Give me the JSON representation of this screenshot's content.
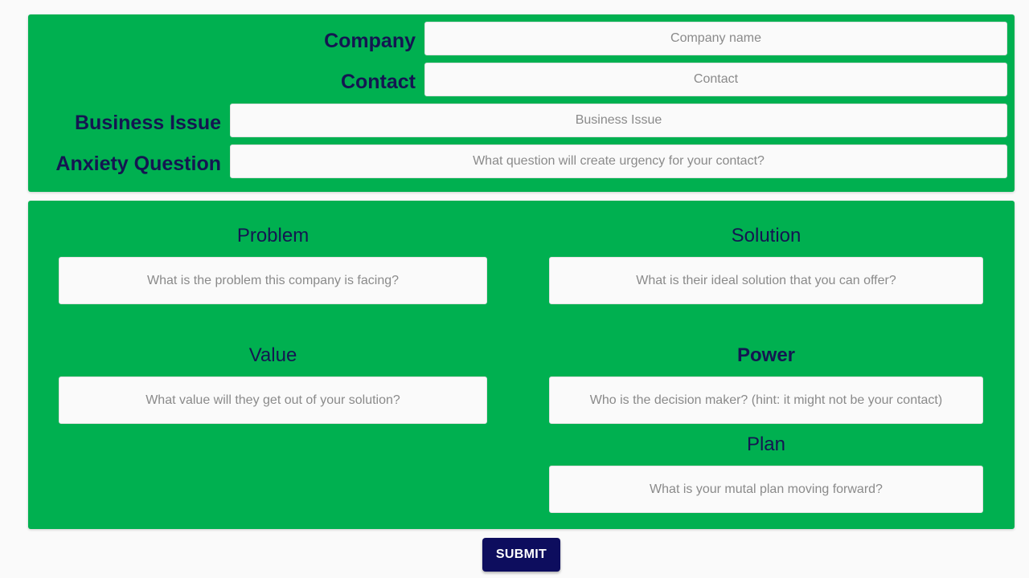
{
  "header_form": {
    "company": {
      "label": "Company",
      "placeholder": "Company name",
      "value": ""
    },
    "contact": {
      "label": "Contact",
      "placeholder": "Contact",
      "value": ""
    },
    "business_issue": {
      "label": "Business Issue",
      "placeholder": "Business Issue",
      "value": ""
    },
    "anxiety_question": {
      "label": "Anxiety Question",
      "placeholder": "What question will create urgency for your contact?",
      "value": ""
    }
  },
  "sections": {
    "problem": {
      "label": "Problem",
      "placeholder": "What is the problem this company is facing?",
      "value": ""
    },
    "solution": {
      "label": "Solution",
      "placeholder": "What is their ideal solution that you can offer?",
      "value": ""
    },
    "value": {
      "label": "Value",
      "placeholder": "What value will they get out of your solution?",
      "value": ""
    },
    "power": {
      "label": "Power",
      "placeholder": "Who is the decision maker? (hint: it might not be your contact)",
      "value": ""
    },
    "plan": {
      "label": "Plan",
      "placeholder": "What is your mutal plan moving forward?",
      "value": ""
    }
  },
  "actions": {
    "submit_label": "SUBMIT"
  },
  "colors": {
    "panel_background": "#00b050",
    "label_text": "#141651",
    "button_background": "#0d0d5e",
    "page_background": "#fafafa"
  }
}
